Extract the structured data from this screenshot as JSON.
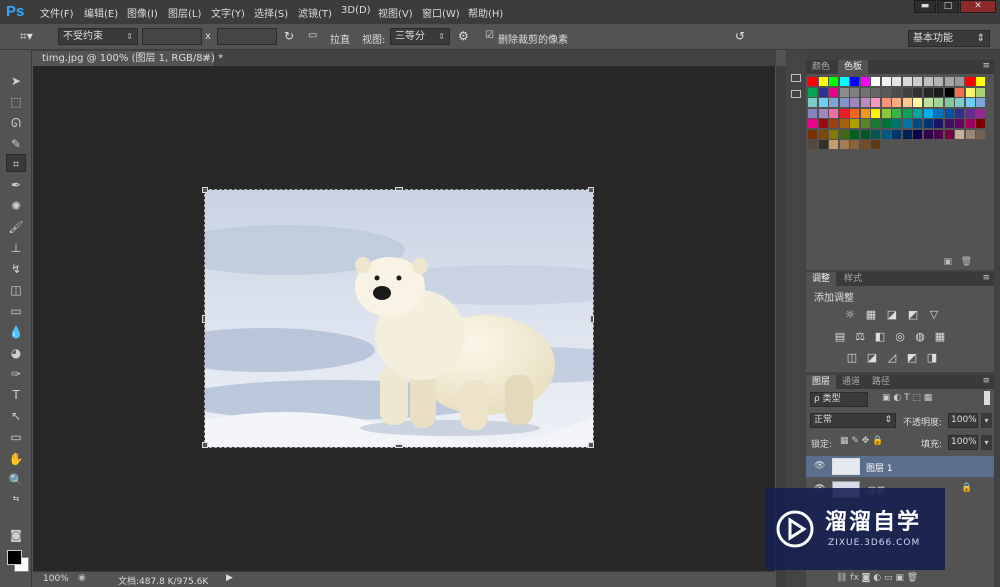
{
  "app": {
    "logo": "Ps"
  },
  "menu": [
    "文件(F)",
    "编辑(E)",
    "图像(I)",
    "图层(L)",
    "文字(Y)",
    "选择(S)",
    "滤镜(T)",
    "3D(D)",
    "视图(V)",
    "窗口(W)",
    "帮助(H)"
  ],
  "window_controls": {
    "minimize": "▬",
    "maximize": "□",
    "close": "✕"
  },
  "options": {
    "ratio": "不受约束",
    "swap": "x",
    "straighten": "拉直",
    "view_label": "视图:",
    "view_value": "三等分",
    "delete_cropped": "删除裁剪的像素",
    "workspace": "基本功能"
  },
  "document": {
    "tab_title": "timg.jpg @ 100% (图层 1, RGB/8#) *",
    "close": "×",
    "zoom": "100%",
    "doc_info": "文档:487.8 K/975.6K"
  },
  "swatches_panel": {
    "tabs": [
      "颜色",
      "色板"
    ],
    "colors": [
      "#ff0000",
      "#ffff00",
      "#00ff00",
      "#00ffff",
      "#0000ff",
      "#ff00ff",
      "#ffffff",
      "#f2f2f2",
      "#e6e6e6",
      "#d9d9d9",
      "#cccccc",
      "#bfbfbf",
      "#b3b3b3",
      "#a6a6a6",
      "#999999",
      "#ff0000",
      "#ffff00",
      "#00a651",
      "#2e3192",
      "#ec008c",
      "#8c8c8c",
      "#808080",
      "#737373",
      "#666666",
      "#595959",
      "#4d4d4d",
      "#404040",
      "#333333",
      "#262626",
      "#1a1a1a",
      "#000000",
      "#f26c4f",
      "#fff568",
      "#acd373",
      "#7accc8",
      "#6dcff6",
      "#7da7d9",
      "#8393ca",
      "#a186be",
      "#bd8cbf",
      "#f49ac1",
      "#f7977a",
      "#f9ad81",
      "#fdc68a",
      "#fff799",
      "#c4df9b",
      "#a3d39c",
      "#82ca9d",
      "#7bcdc8",
      "#6ecff6",
      "#7ea7d8",
      "#8781bd",
      "#a187be",
      "#f06eaa",
      "#ed1c24",
      "#f26522",
      "#f7941d",
      "#fff200",
      "#8dc63f",
      "#39b54a",
      "#00a651",
      "#00a99d",
      "#00aeef",
      "#0072bc",
      "#0054a6",
      "#2e3192",
      "#662d91",
      "#92278f",
      "#ec008c",
      "#9e0b0f",
      "#a0410d",
      "#a3620a",
      "#aba000",
      "#598527",
      "#197b30",
      "#007236",
      "#00746b",
      "#0076a3",
      "#004b80",
      "#003471",
      "#1b1464",
      "#440e62",
      "#630460",
      "#9e005d",
      "#790000",
      "#7b2e00",
      "#7d4900",
      "#827b00",
      "#406618",
      "#005e20",
      "#005826",
      "#005952",
      "#005b7f",
      "#003663",
      "#002157",
      "#0d004c",
      "#32004b",
      "#4b0049",
      "#7b0046",
      "#c7b299",
      "#998675",
      "#736357",
      "#534741",
      "#37302a",
      "#c69c6d",
      "#a67c52",
      "#8c6239",
      "#754c24",
      "#603913"
    ]
  },
  "adjustments_panel": {
    "tabs": [
      "调整",
      "样式"
    ],
    "title": "添加调整",
    "icons": [
      "☼",
      "▦",
      "◪",
      "◩",
      "▽",
      "▤",
      "⚖",
      "◧",
      "◎",
      "◍",
      "▦",
      "◫",
      "◪",
      "◿",
      "◩",
      "◨"
    ]
  },
  "layers_panel": {
    "tabs": [
      "图层",
      "通道",
      "路径"
    ],
    "filter": "ρ 类型",
    "blend_mode": "正常",
    "opacity_label": "不透明度:",
    "opacity_value": "100%",
    "lock_label": "锁定:",
    "fill_label": "填充:",
    "fill_value": "100%",
    "layers": [
      {
        "name": "图层 1",
        "selected": true
      },
      {
        "name": "背景",
        "selected": false
      }
    ]
  },
  "watermark": {
    "brand": "溜溜自学",
    "url": "ZIXUE.3D66.COM"
  }
}
